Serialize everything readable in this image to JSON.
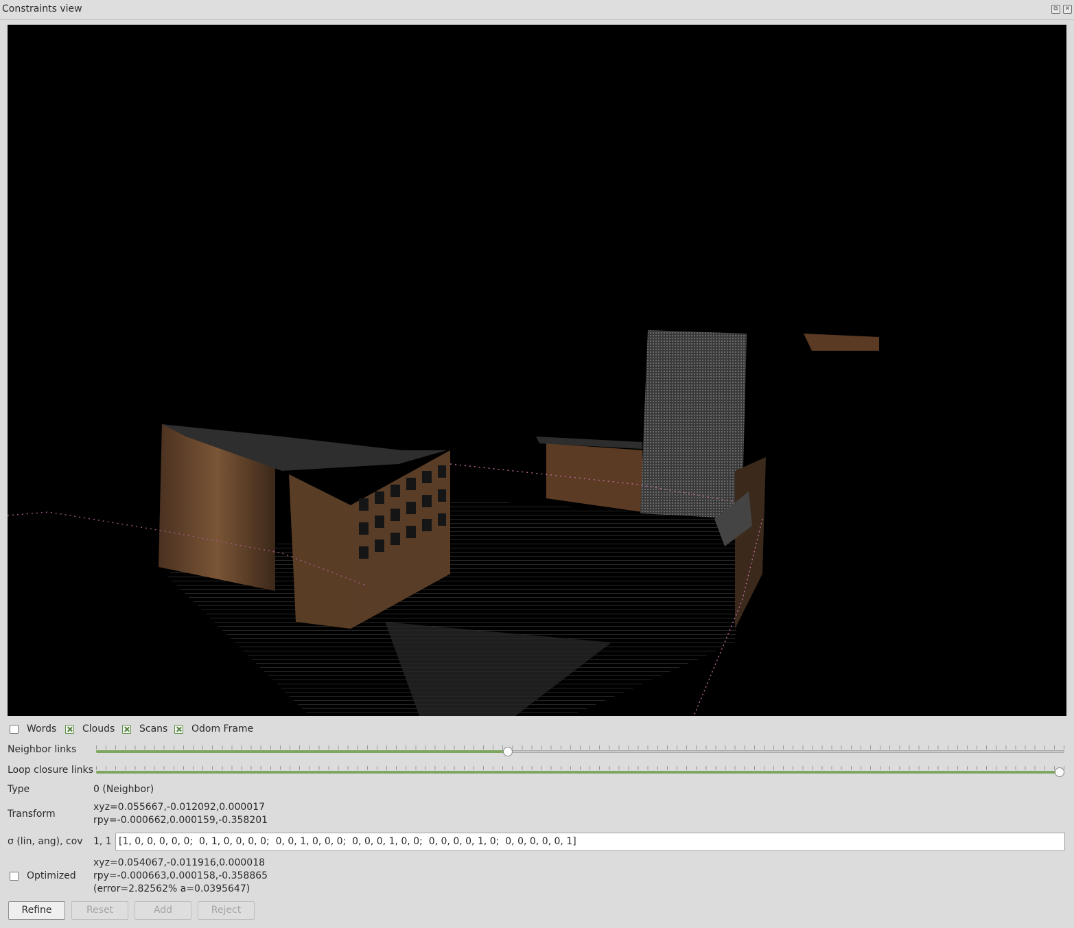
{
  "window": {
    "title": "Constraints view"
  },
  "checkboxes": [
    {
      "label": "Words",
      "checked": false
    },
    {
      "label": "Clouds",
      "checked": true
    },
    {
      "label": "Scans",
      "checked": true
    },
    {
      "label": "Odom Frame",
      "checked": true
    }
  ],
  "sliders": {
    "neighbor": {
      "label": "Neighbor links",
      "value_fraction": 0.425
    },
    "loop_closure": {
      "label": "Loop closure links",
      "value_fraction": 1.0
    }
  },
  "type": {
    "label": "Type",
    "value": "0 (Neighbor)"
  },
  "transform": {
    "label": "Transform",
    "xyz": "xyz=0.055667,-0.012092,0.000017",
    "rpy": "rpy=-0.000662,0.000159,-0.358201"
  },
  "sigma": {
    "label": "σ (lin, ang), cov",
    "value": "1, 1",
    "cov": "[1, 0, 0, 0, 0, 0;  0, 1, 0, 0, 0, 0;  0, 0, 1, 0, 0, 0;  0, 0, 0, 1, 0, 0;  0, 0, 0, 0, 1, 0;  0, 0, 0, 0, 0, 1]"
  },
  "optimized": {
    "label": "Optimized",
    "checked": false,
    "xyz": "xyz=0.054067,-0.011916,0.000018",
    "rpy": "rpy=-0.000663,0.000158,-0.358865",
    "error": "(error=2.82562% a=0.0395647)"
  },
  "buttons": {
    "refine": "Refine",
    "reset": "Reset",
    "add": "Add",
    "reject": "Reject"
  },
  "colors": {
    "accent": "#7ea65e",
    "viewer_bg": "#000000",
    "wood": "#6b4a2e"
  }
}
